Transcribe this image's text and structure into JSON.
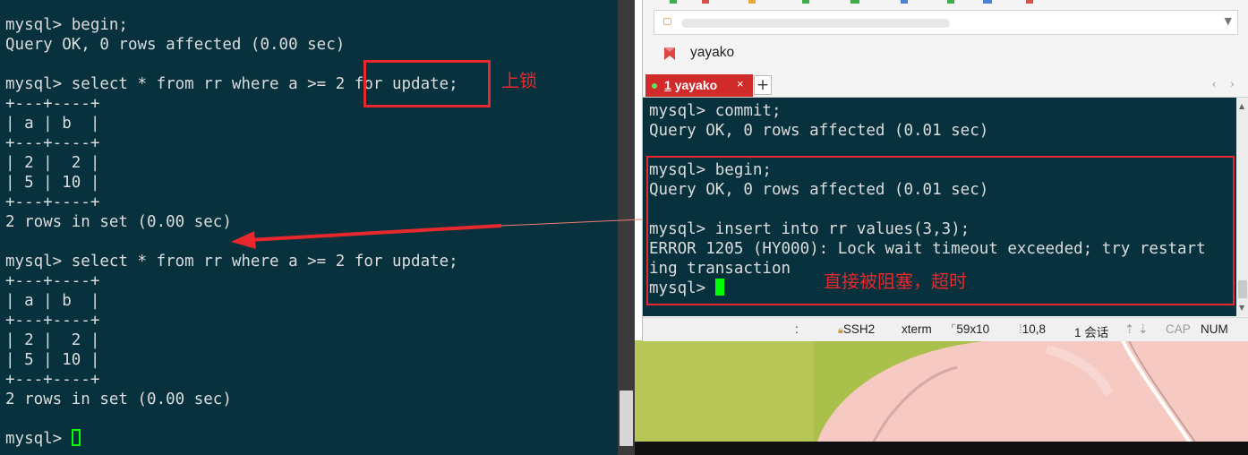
{
  "left_terminal": {
    "lines": [
      "mysql> begin;",
      "Query OK, 0 rows affected (0.00 sec)",
      "",
      "mysql> select * from rr where a >= 2 for update;",
      "+---+----+",
      "| a | b  |",
      "+---+----+",
      "| 2 |  2 |",
      "| 5 | 10 |",
      "+---+----+",
      "2 rows in set (0.00 sec)",
      "",
      "mysql> select * from rr where a >= 2 for update;",
      "+---+----+",
      "| a | b  |",
      "+---+----+",
      "| 2 |  2 |",
      "| 5 | 10 |",
      "+---+----+",
      "2 rows in set (0.00 sec)",
      "",
      "mysql> "
    ]
  },
  "xshell": {
    "session_name": "yayako",
    "tab": {
      "number": "1",
      "name": "yayako",
      "close": "×"
    },
    "add_tab": "+",
    "tab_nav": "‹ ›",
    "terminal_lines": [
      "mysql> commit;",
      "Query OK, 0 rows affected (0.01 sec)",
      "",
      "mysql> begin;",
      "Query OK, 0 rows affected (0.01 sec)",
      "",
      "mysql> insert into rr values(3,3);",
      "ERROR 1205 (HY000): Lock wait timeout exceeded; try restart",
      "ing transaction",
      "mysql> "
    ],
    "status": {
      "colon": ":",
      "protocol": "SSH2",
      "term": "xterm",
      "size": "59x10",
      "cursor_pos": "10,8",
      "sessions": "1 会话",
      "caps": "CAP",
      "num": "NUM"
    }
  },
  "annotations": {
    "lock": "上锁",
    "blocked": "直接被阻塞，超时"
  },
  "colors": {
    "terminal_bg": "#06313d",
    "terminal_fg": "#dcdcdc",
    "annotation": "#e8282d",
    "tab_active": "#d02a2a",
    "cursor": "#00ff00"
  }
}
